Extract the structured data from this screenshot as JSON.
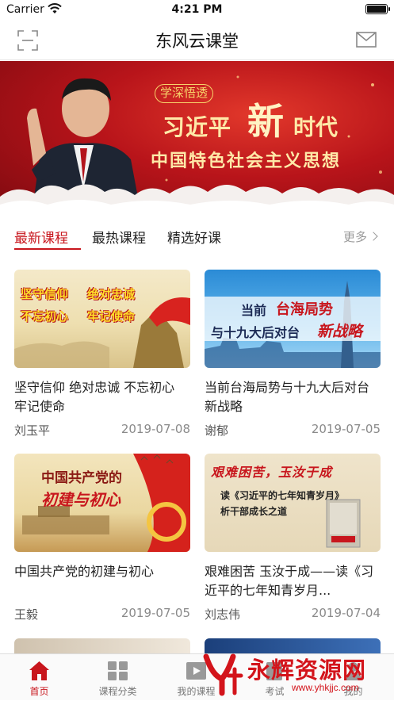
{
  "status_bar": {
    "carrier": "Carrier",
    "time": "4:21 PM",
    "battery_level": 1.0
  },
  "nav": {
    "title": "东风云课堂"
  },
  "banner": {
    "badge": "学深悟透",
    "name": "习近平",
    "new_char": "新",
    "era": "时代",
    "subtitle": "中国特色社会主义思想"
  },
  "tabs": [
    {
      "label": "最新课程",
      "active": true
    },
    {
      "label": "最热课程",
      "active": false
    },
    {
      "label": "精选好课",
      "active": false
    }
  ],
  "more_label": "更多",
  "courses": [
    {
      "title": "坚守信仰 绝对忠诚 不忘初心 牢记使命",
      "author": "刘玉平",
      "date": "2019-07-08",
      "thumb_text": [
        "坚守信仰",
        "绝对忠诚",
        "不忘初心",
        "牢记使命"
      ]
    },
    {
      "title": "当前台海局势与十九大后对台新战略",
      "author": "谢郁",
      "date": "2019-07-05",
      "thumb_text": [
        "当前",
        "台海局势",
        "与十九大后对台",
        "新战略"
      ]
    },
    {
      "title": "中国共产党的初建与初心",
      "author": "王毅",
      "date": "2019-07-05",
      "thumb_text": [
        "中国共产党的",
        "初建与初心"
      ]
    },
    {
      "title": "艰难困苦 玉汝于成——读《习近平的七年知青岁月...",
      "author": "刘志伟",
      "date": "2019-07-04",
      "thumb_text": [
        "艰难困苦，玉汝于成",
        "读《习近平的七年知青岁月》",
        "析干部成长之道"
      ]
    }
  ],
  "tab_bar": [
    {
      "label": "首页",
      "icon": "home-icon",
      "active": true
    },
    {
      "label": "课程分类",
      "icon": "grid-icon",
      "active": false
    },
    {
      "label": "我的课程",
      "icon": "play-icon",
      "active": false
    },
    {
      "label": "考试",
      "icon": "edit-icon",
      "active": false
    },
    {
      "label": "我的",
      "icon": "person-icon",
      "active": false
    }
  ],
  "watermark": {
    "title": "永辉资源网",
    "url": "www.yhkjjc.com"
  },
  "colors": {
    "accent": "#c8161d",
    "banner_red": "#b8141a"
  }
}
